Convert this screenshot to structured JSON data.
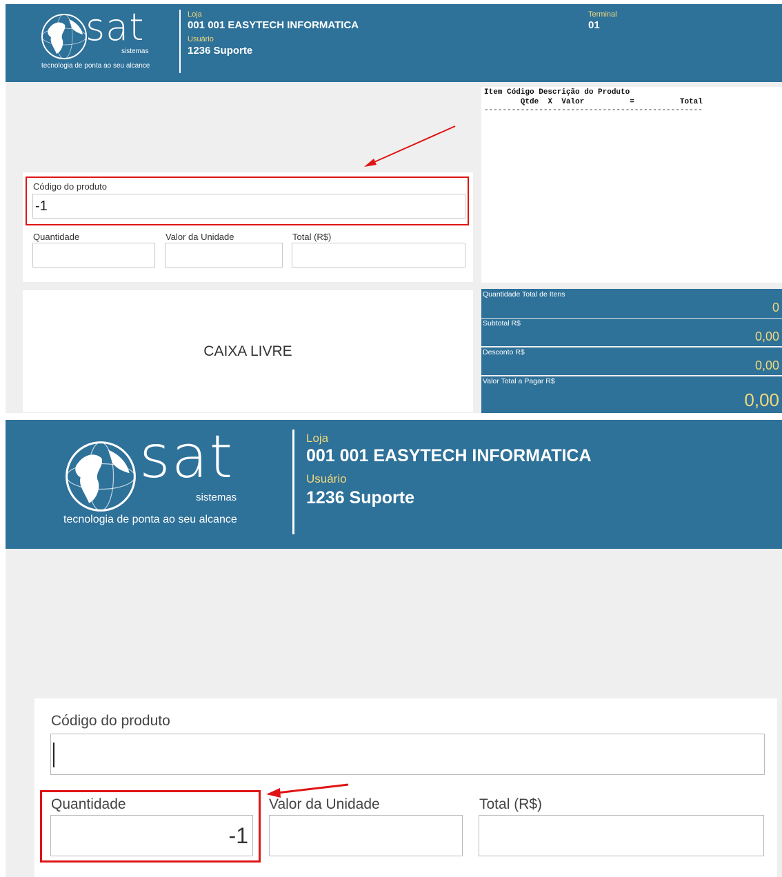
{
  "logo": {
    "brand": "sat",
    "sub": "sistemas",
    "tagline": "tecnologia de ponta ao seu alcance"
  },
  "header": {
    "loja_label": "Loja",
    "loja_value": "001 001 EASYTECH INFORMATICA",
    "usuario_label": "Usuário",
    "usuario_value": "1236 Suporte",
    "terminal_label": "Terminal",
    "terminal_value": "01"
  },
  "form": {
    "codigo_label": "Código do produto",
    "codigo_value": "-1",
    "quantidade_label": "Quantidade",
    "quantidade_value": "",
    "valor_unidade_label": "Valor da Unidade",
    "valor_unidade_value": "",
    "total_label": "Total (R$)",
    "total_value": ""
  },
  "status": {
    "text": "CAIXA LIVRE"
  },
  "receipt": {
    "line1": "Item Código Descrição do Produto",
    "line2": "        Qtde  X  Valor          =          Total",
    "separator": "------------------------------------------------"
  },
  "summary": {
    "qtd_itens_label": "Quantidade Total de Itens",
    "qtd_itens_value": "0",
    "subtotal_label": "Subtotal R$",
    "subtotal_value": "0,00",
    "desconto_label": "Desconto R$",
    "desconto_value": "0,00",
    "total_pagar_label": "Valor Total a Pagar R$",
    "total_pagar_value": "0,00"
  },
  "zoom_form": {
    "codigo_value": "",
    "quantidade_value": "-1"
  },
  "colors": {
    "header_bg": "#2e7199",
    "label_yellow": "#f3d97a",
    "highlight_red": "#e01414"
  }
}
